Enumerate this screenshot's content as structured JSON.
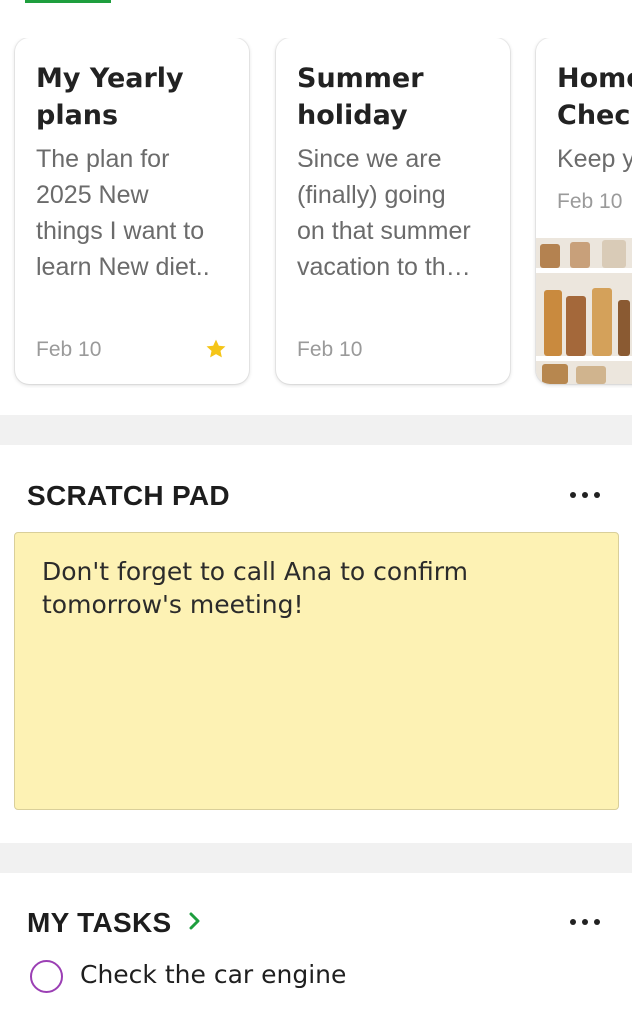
{
  "notes": [
    {
      "title": "My Yearly\nplans",
      "preview": "The plan for\n2025 New\nthings I want to\nlearn New diet..",
      "date": "Feb 10",
      "starred": true
    },
    {
      "title": "Summer\nholiday",
      "preview": "Since we are\n(finally) going\non that summer\nvacation to th…",
      "date": "Feb 10",
      "starred": false
    },
    {
      "title": "Home\nCheck",
      "preview": "Keep y",
      "date": "Feb 10",
      "starred": false,
      "has_image": true
    }
  ],
  "scratch_pad": {
    "heading": "SCRATCH PAD",
    "text": "Don't forget to call Ana to confirm tomorrow's meeting!"
  },
  "tasks": {
    "heading": "MY TASKS",
    "items": [
      {
        "label": "Check the car engine",
        "done": false
      }
    ]
  },
  "colors": {
    "accent_green": "#1e9e3e",
    "star_yellow": "#f5c518",
    "scratch_pad_bg": "#fdf2b4",
    "task_circle": "#9b3fb4"
  }
}
